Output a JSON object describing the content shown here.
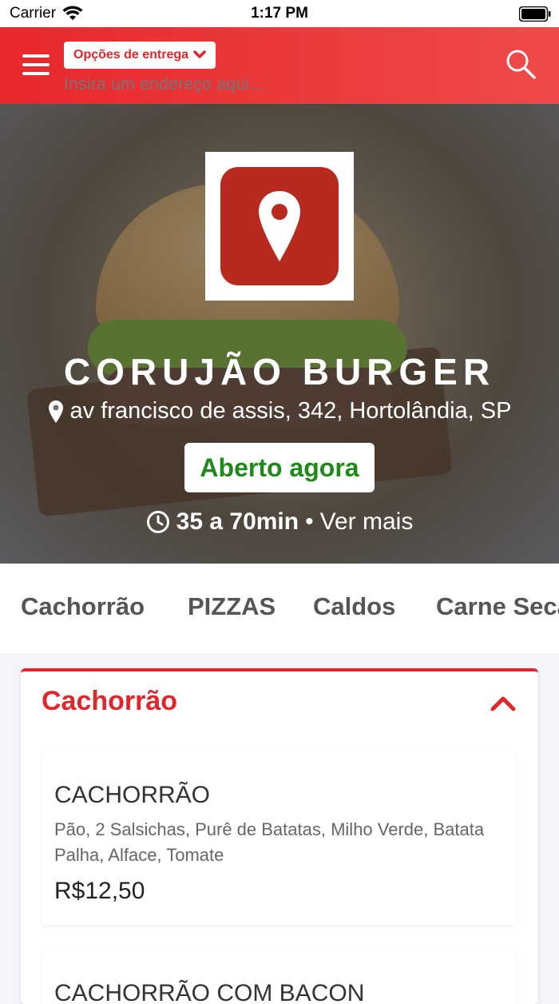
{
  "status_bar": {
    "carrier": "Carrier",
    "time": "1:17 PM"
  },
  "header": {
    "delivery_options_label": "Opções de entrega",
    "address_placeholder": "Insira um endereço aqui..."
  },
  "restaurant": {
    "name": "CORUJÃO BURGER",
    "address": "av francisco de assis, 342, Hortolândia, SP",
    "status": "Aberto agora",
    "delivery_time": "35 a 70min",
    "separator": "•",
    "see_more": "Ver mais"
  },
  "categories": [
    "Cachorrão",
    "PIZZAS",
    "Caldos",
    "Carne Seca"
  ],
  "section": {
    "title": "Cachorrão",
    "items": [
      {
        "name": "CACHORRÃO",
        "description": "Pão, 2 Salsichas, Purê de Batatas, Milho Verde, Batata Palha, Alface, Tomate",
        "price": "R$12,50"
      },
      {
        "name": "CACHORRÃO COM BACON"
      }
    ]
  },
  "colors": {
    "brand_red": "#e0262b",
    "open_green": "#1e8a1a"
  }
}
